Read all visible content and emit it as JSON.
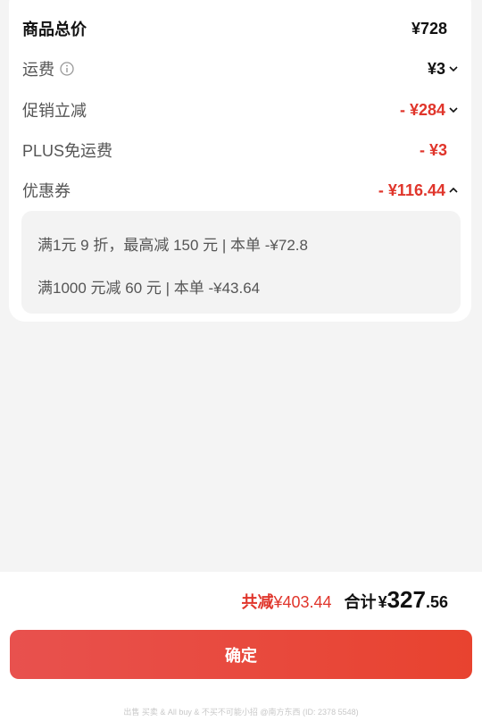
{
  "summary_card": {
    "total_label": "商品总价",
    "total_value": "¥728",
    "shipping_label": "运费",
    "shipping_value": "¥3",
    "promo_label": "促销立减",
    "promo_value": "- ¥284",
    "plus_label": "PLUS免运费",
    "plus_value": "- ¥3",
    "coupon_label": "优惠券",
    "coupon_value": "- ¥116.44"
  },
  "coupons": [
    "满1元 9 折，最高减 150 元 | 本单 -¥72.8",
    "满1000 元减 60 元 | 本单 -¥43.64"
  ],
  "bottom": {
    "save_label": "共减",
    "save_amount": "¥403.44",
    "total_label": "合计",
    "total_currency": "¥",
    "total_integer": "327",
    "total_decimal": ".56",
    "confirm_label": "确定"
  },
  "footer_watermark": "出售 买卖 & All buy & 不买不可能小招 @南方东西 (ID: 2378 5548)",
  "colors": {
    "accent": "#e0352b",
    "button": "#e8473d",
    "background": "#f4f4f4"
  }
}
